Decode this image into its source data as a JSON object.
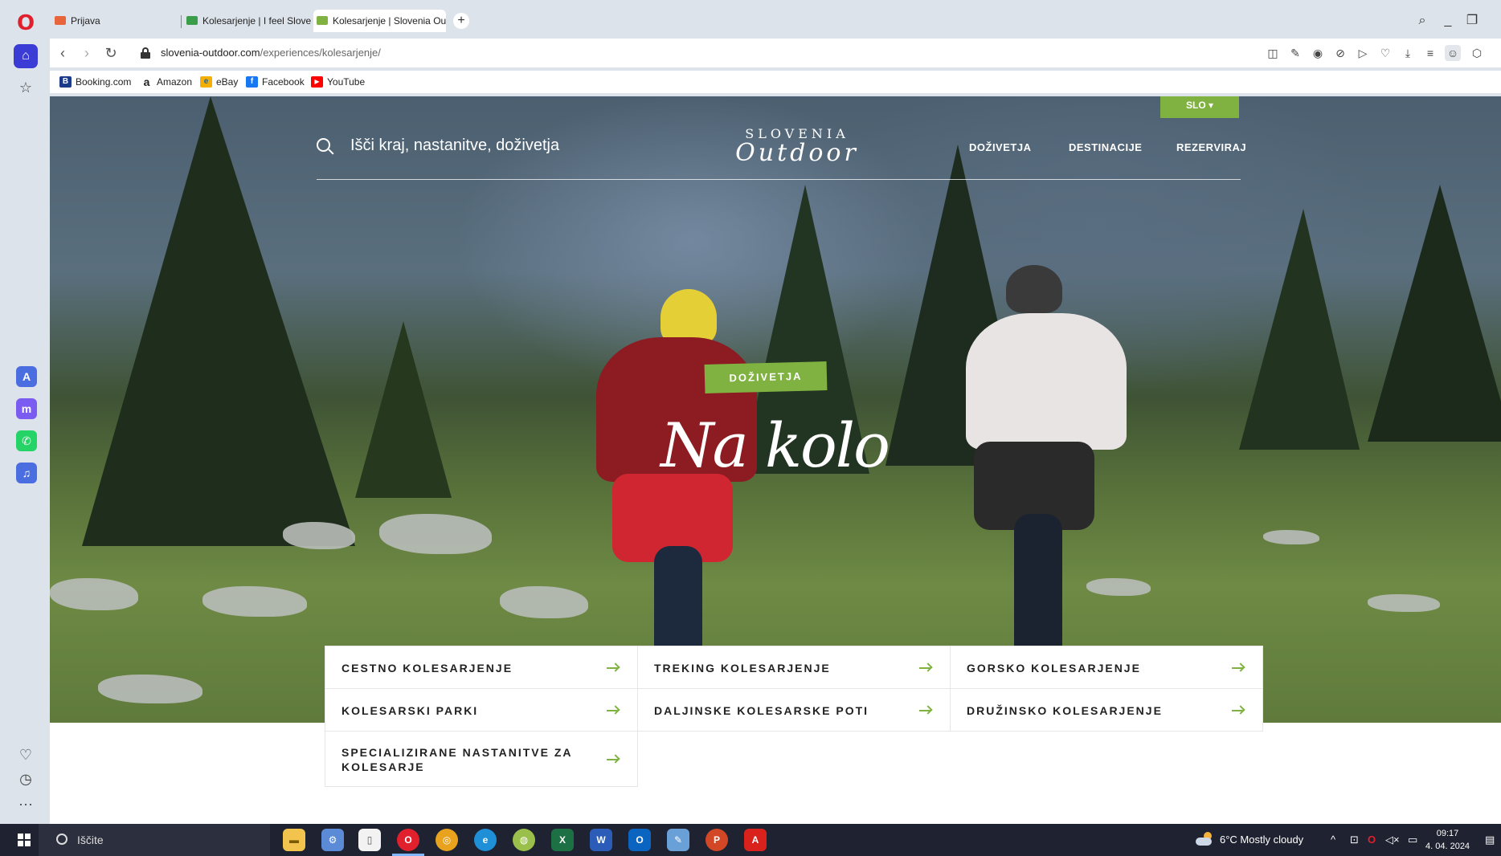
{
  "browser": {
    "tabs": [
      {
        "title": "Prijava",
        "favicon_color": "#e8643a"
      },
      {
        "title": "Kolesarjenje | I feel Sloven",
        "favicon_color": "#3a9d4a"
      },
      {
        "title": "Kolesarjenje | Slovenia Ou",
        "favicon_color": "#7fb241",
        "active": true
      }
    ],
    "new_tab_label": "+",
    "url_domain": "slovenia-outdoor.com",
    "url_path": "/experiences/kolesarjenje/",
    "bookmarks": [
      {
        "label": "Booking.com",
        "icon": "B",
        "color": "#1b3b8a"
      },
      {
        "label": "Amazon",
        "icon": "a",
        "color": "#222222"
      },
      {
        "label": "eBay",
        "icon": "e",
        "color": "#e53238"
      },
      {
        "label": "Facebook",
        "icon": "f",
        "color": "#1877f2"
      },
      {
        "label": "YouTube",
        "icon": "▶",
        "color": "#ff0000"
      }
    ]
  },
  "site": {
    "search_placeholder": "Išči kraj, nastanitve, doživetja",
    "logo_top": "SLOVENIA",
    "logo_bottom": "Outdoor",
    "nav": [
      "DOŽIVETJA",
      "DESTINACIJE",
      "REZERVIRAJ"
    ],
    "language": "SLO ▾",
    "badge": "DOŽIVETJA",
    "hero_title": "Na kolo",
    "accent_color": "#7fb241",
    "categories": [
      "CESTNO KOLESARJENJE",
      "TREKING KOLESARJENJE",
      "GORSKO KOLESARJENJE",
      "KOLESARSKI PARKI",
      "DALJINSKE KOLESARSKE POTI",
      "DRUŽINSKO KOLESARJENJE",
      "SPECIALIZIRANE NASTANITVE ZA KOLESARJE"
    ]
  },
  "taskbar": {
    "search_text": "Iščite",
    "weather": "6°C  Mostly cloudy",
    "time": "09:17",
    "date": "4. 04. 2024"
  }
}
